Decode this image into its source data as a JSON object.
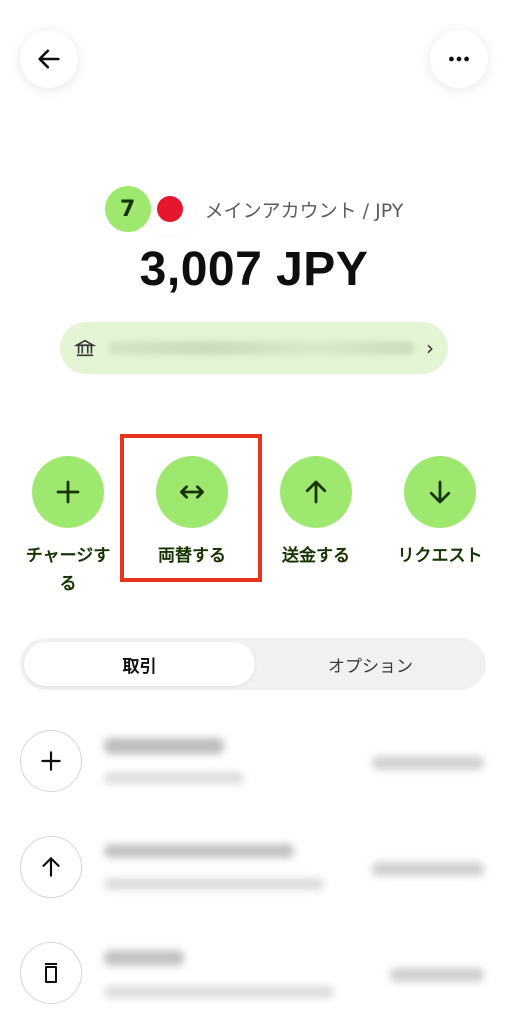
{
  "header": {
    "back_icon": "arrow-left-icon",
    "more_icon": "more-horizontal-icon"
  },
  "account": {
    "brand_logo_text": "7",
    "flag_icon": "japan-flag-icon",
    "name": "メインアカウント / JPY",
    "balance": "3,007 JPY"
  },
  "bank_details": {
    "icon": "bank-icon",
    "chevron": "›"
  },
  "actions": [
    {
      "label": "チャージする",
      "icon": "plus-icon"
    },
    {
      "label": "両替する",
      "icon": "swap-arrows-icon"
    },
    {
      "label": "送金する",
      "icon": "arrow-up-icon"
    },
    {
      "label": "リクエスト",
      "icon": "arrow-down-icon"
    }
  ],
  "tabs": [
    {
      "label": "取引",
      "active": true
    },
    {
      "label": "オプション",
      "active": false
    }
  ],
  "transactions": [
    {
      "icon": "plus-icon"
    },
    {
      "icon": "arrow-up-icon"
    },
    {
      "icon": "card-icon"
    }
  ],
  "colors": {
    "accent": "#9fe870",
    "accent_dark": "#163300",
    "highlight": "#e8341c"
  }
}
